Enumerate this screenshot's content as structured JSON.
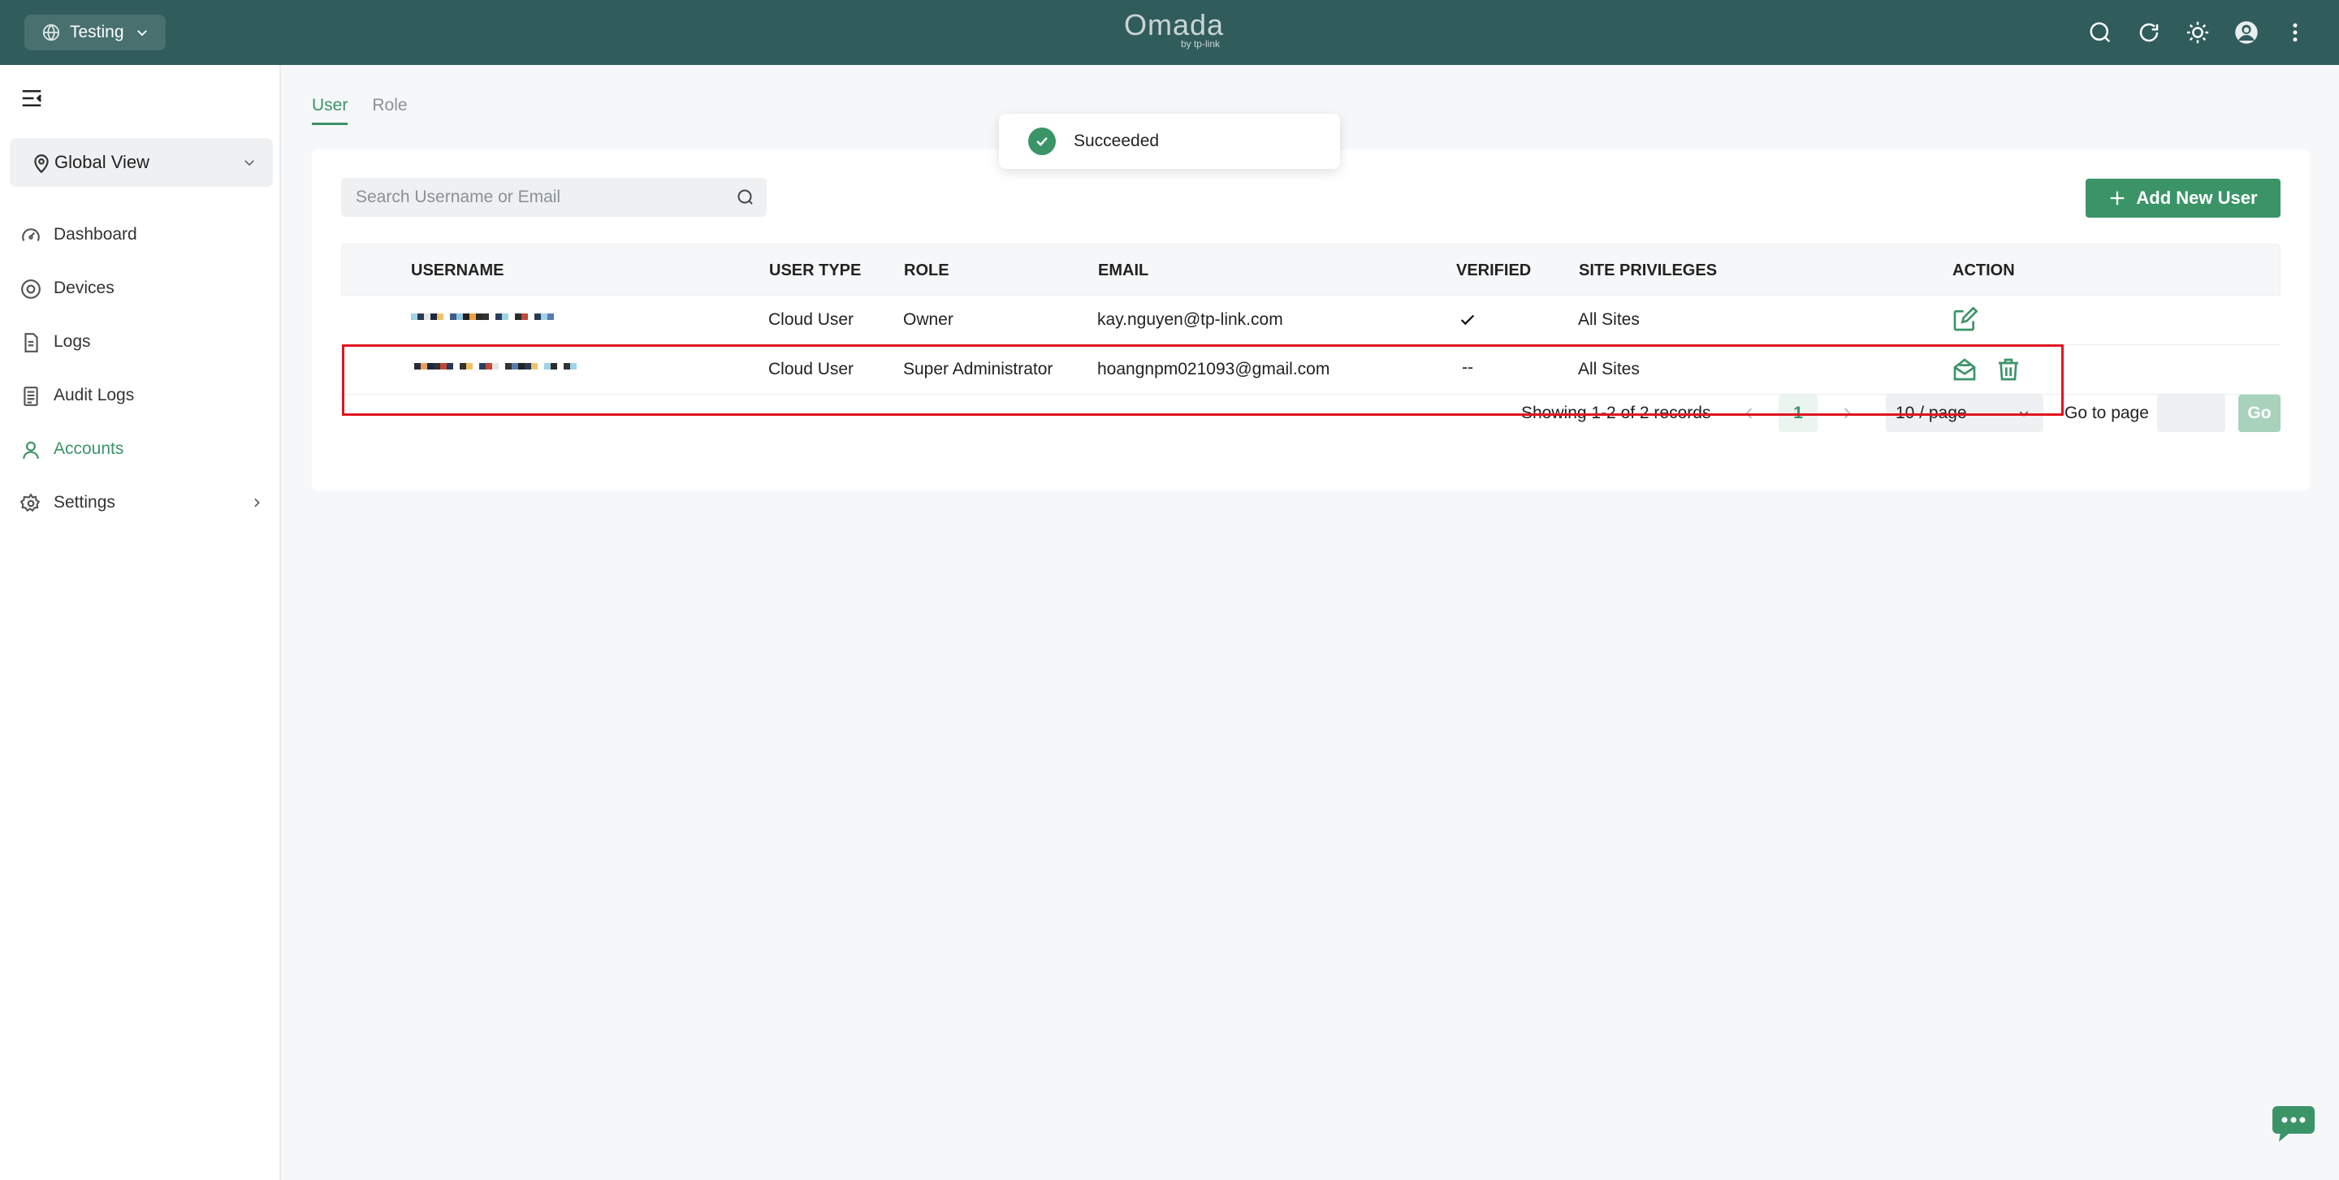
{
  "header": {
    "site_selector": "Testing",
    "brand": "Omada",
    "brand_sub": "by tp-link",
    "icons": [
      "search-icon",
      "refresh-icon",
      "theme-sun-icon",
      "avatar",
      "more-vertical-icon"
    ]
  },
  "sidebar": {
    "view_selector": "Global View",
    "items": [
      {
        "label": "Dashboard",
        "icon": "dashboard-gauge-icon"
      },
      {
        "label": "Devices",
        "icon": "devices-target-icon"
      },
      {
        "label": "Logs",
        "icon": "logs-document-icon"
      },
      {
        "label": "Audit Logs",
        "icon": "audit-logs-icon"
      },
      {
        "label": "Accounts",
        "icon": "accounts-user-icon",
        "active": true
      },
      {
        "label": "Settings",
        "icon": "settings-gear-icon"
      }
    ]
  },
  "tabs": [
    {
      "label": "User",
      "active": true
    },
    {
      "label": "Role",
      "active": false
    }
  ],
  "toast": {
    "message": "Succeeded"
  },
  "toolbar": {
    "search_placeholder": "Search Username or Email",
    "add_button": "Add New User"
  },
  "table": {
    "columns": [
      "USERNAME",
      "USER TYPE",
      "ROLE",
      "EMAIL",
      "VERIFIED",
      "SITE PRIVILEGES",
      "ACTION"
    ],
    "rows": [
      {
        "user_type": "Cloud User",
        "role": "Owner",
        "email": "kay.nguyen@tp-link.com",
        "verified": "check",
        "site_privileges": "All Sites",
        "actions": [
          "edit-icon"
        ]
      },
      {
        "user_type": "Cloud User",
        "role": "Super Administrator",
        "email": "hoangnpm021093@gmail.com",
        "verified": "--",
        "site_privileges": "All Sites",
        "actions": [
          "resend-email-icon",
          "delete-trash-icon"
        ]
      }
    ]
  },
  "pagination": {
    "info": "Showing 1-2 of 2 records",
    "current_page": "1",
    "per_page": "10 / page",
    "goto_label": "Go to page",
    "go_button": "Go"
  },
  "colors": {
    "topbar": "#315c5c",
    "accent": "#3b9468",
    "highlight": "#e0141e"
  }
}
